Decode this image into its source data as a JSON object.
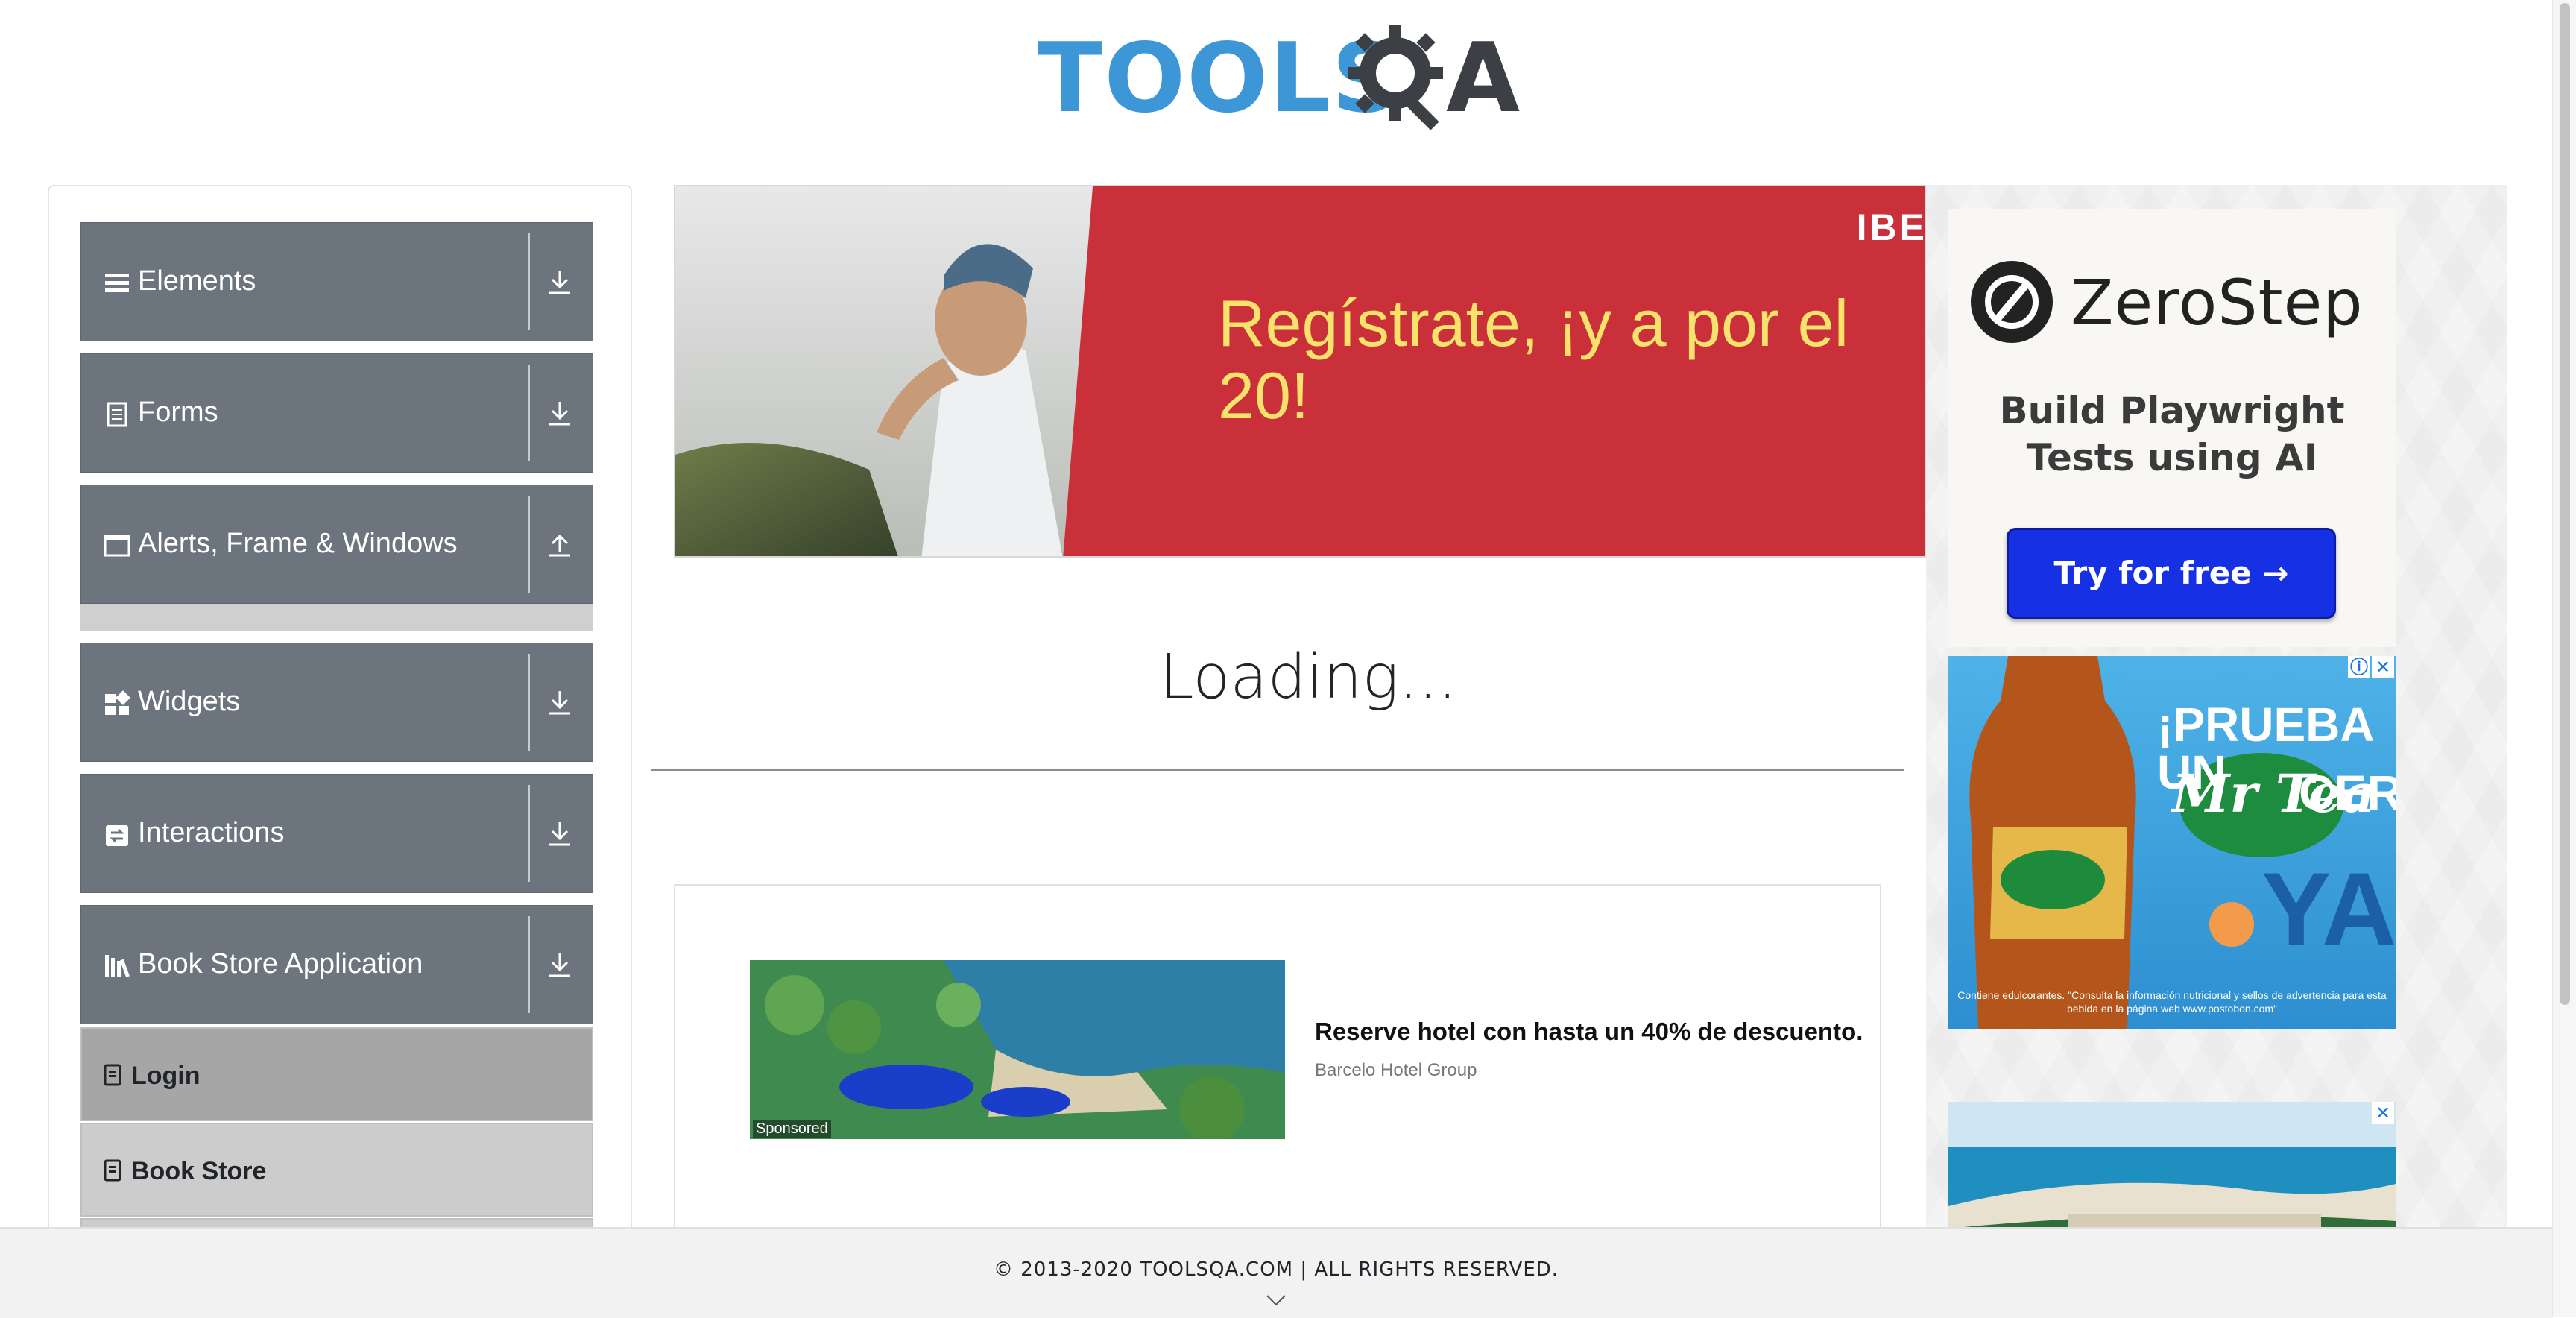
{
  "header": {
    "logo_text": "TOOLSQA",
    "logo_part_tools": "TOOLS",
    "logo_part_a": "A"
  },
  "sidebar": {
    "groups": [
      {
        "label": "Elements",
        "icon": "list-icon",
        "state": "collapsed"
      },
      {
        "label": "Forms",
        "icon": "document-icon",
        "state": "collapsed"
      },
      {
        "label": "Alerts, Frame & Windows",
        "icon": "window-icon",
        "state": "expanded"
      },
      {
        "label": "Widgets",
        "icon": "widgets-icon",
        "state": "collapsed"
      },
      {
        "label": "Interactions",
        "icon": "interactions-icon",
        "state": "collapsed"
      },
      {
        "label": "Book Store Application",
        "icon": "library-icon",
        "state": "expanded"
      }
    ],
    "book_store_items": [
      {
        "label": "Login",
        "active": true
      },
      {
        "label": "Book Store",
        "active": false
      }
    ]
  },
  "banner_ad": {
    "brand": "IBE",
    "slogan": "Regístrate, ¡y a por el 20!"
  },
  "zerostep_ad": {
    "brand": "ZeroStep",
    "tagline_line1": "Build Playwright",
    "tagline_line2": "Tests using AI",
    "cta": "Try for free →"
  },
  "tea_ad": {
    "headline": "¡PRUEBA UN",
    "product": "Mr Tea",
    "cero": "CERO",
    "ya": "YA!",
    "fine_print": "Contiene edulcorantes. \"Consulta la información nutricional y sellos de advertencia para esta bebida en la página web www.postobon.com\""
  },
  "main": {
    "loading_text": "Loading..."
  },
  "sponsored_card": {
    "badge": "Sponsored",
    "headline": "Reserve hotel con hasta un 40% de descuento.",
    "advertiser": "Barcelo Hotel Group"
  },
  "footer": {
    "copyright": "© 2013-2020 TOOLSQA.COM | ALL RIGHTS RESERVED."
  },
  "colors": {
    "sidebar_group_bg": "#6c757d",
    "item_active_bg": "#a6a6a6",
    "item_bg": "#cccccc",
    "banner_red": "#c9303a",
    "cta_blue": "#1630e4",
    "logo_blue": "#3d96d6"
  }
}
